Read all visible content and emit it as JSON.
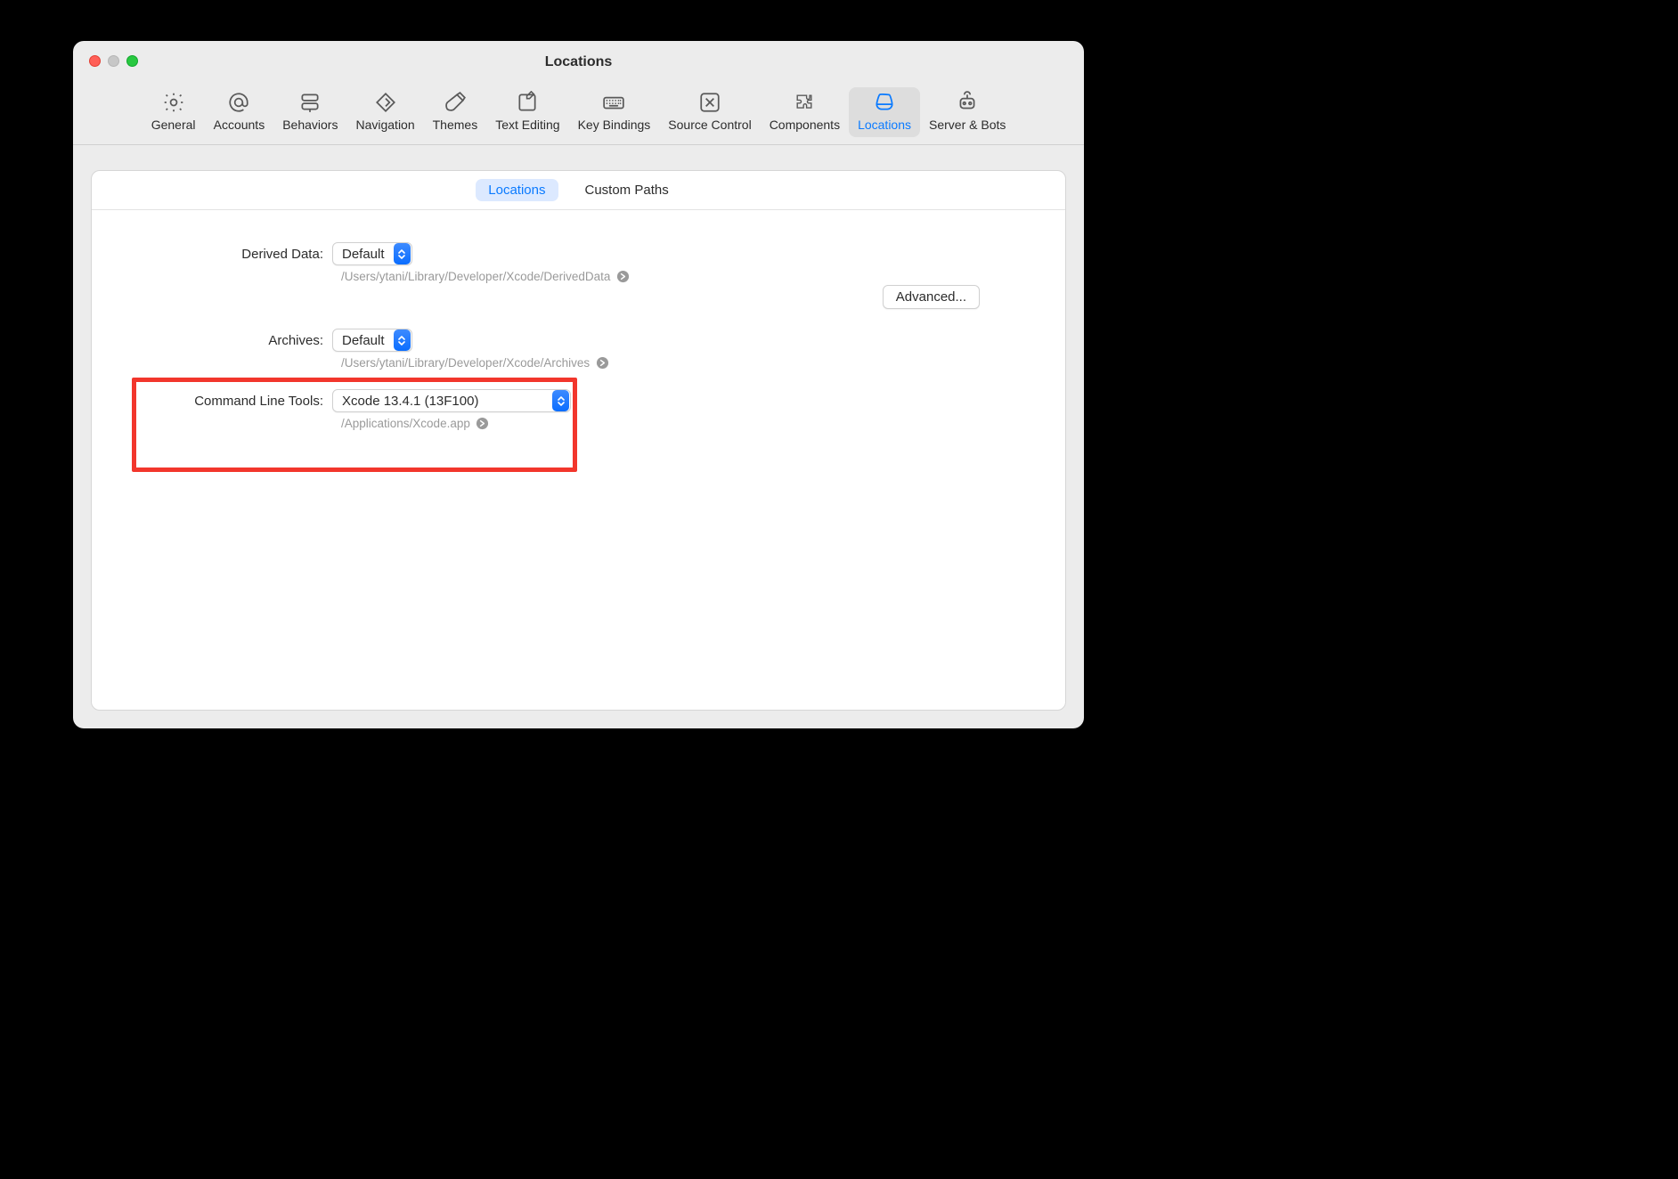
{
  "window": {
    "title": "Locations"
  },
  "toolbar": {
    "items": [
      {
        "label": "General"
      },
      {
        "label": "Accounts"
      },
      {
        "label": "Behaviors"
      },
      {
        "label": "Navigation"
      },
      {
        "label": "Themes"
      },
      {
        "label": "Text Editing"
      },
      {
        "label": "Key Bindings"
      },
      {
        "label": "Source Control"
      },
      {
        "label": "Components"
      },
      {
        "label": "Locations"
      },
      {
        "label": "Server & Bots"
      }
    ],
    "selected": "Locations"
  },
  "tabs": {
    "items": [
      "Locations",
      "Custom Paths"
    ],
    "active": "Locations"
  },
  "form": {
    "derived_label": "Derived Data:",
    "derived_value": "Default",
    "derived_path": "/Users/ytani/Library/Developer/Xcode/DerivedData",
    "advanced_label": "Advanced...",
    "archives_label": "Archives:",
    "archives_value": "Default",
    "archives_path": "/Users/ytani/Library/Developer/Xcode/Archives",
    "clt_label": "Command Line Tools:",
    "clt_value": "Xcode 13.4.1 (13F100)",
    "clt_path": "/Applications/Xcode.app"
  }
}
